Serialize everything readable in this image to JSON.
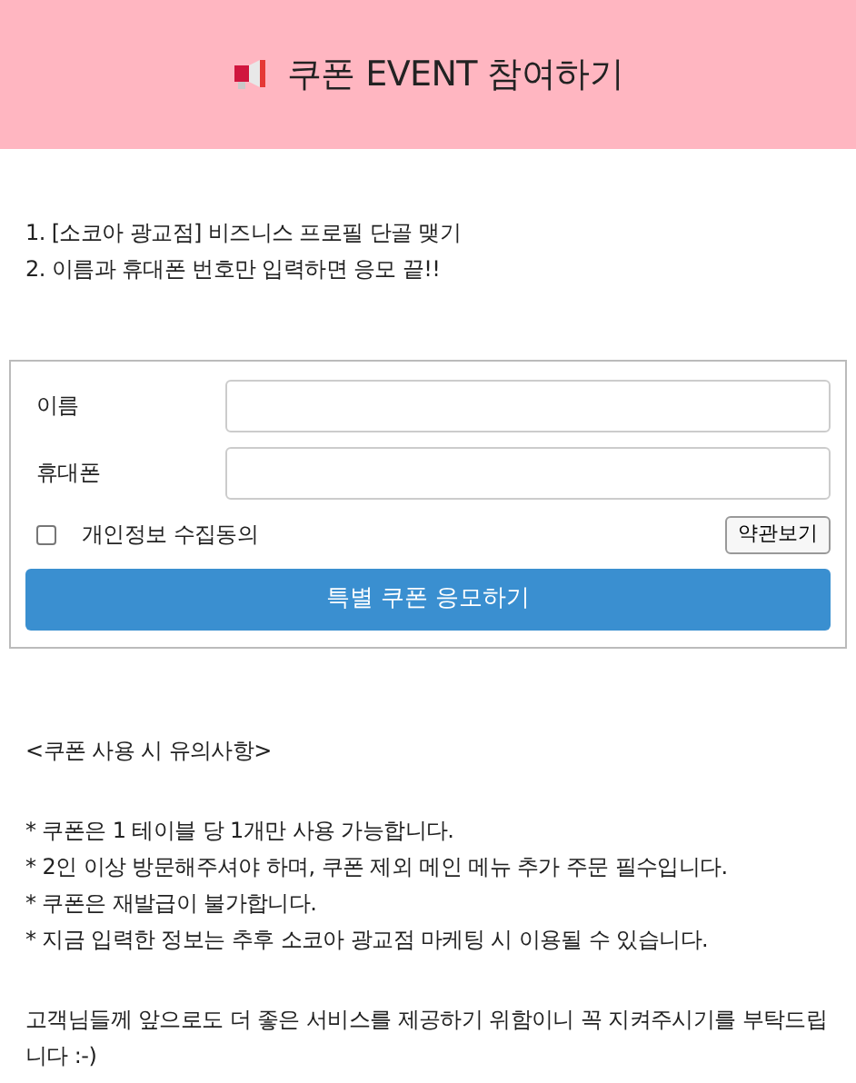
{
  "header": {
    "title": "쿠폰 EVENT 참여하기"
  },
  "intro": [
    "1. [소코아 광교점] 비즈니스 프로필 단골 맺기",
    "2. 이름과 휴대폰 번호만 입력하면 응모 끝!!"
  ],
  "form": {
    "fields": [
      {
        "label": "이름"
      },
      {
        "label": "휴대폰"
      }
    ],
    "consent": {
      "label": "개인정보 수집동의",
      "checked": false,
      "terms_button": "약관보기"
    },
    "submit": "특별 쿠폰 응모하기"
  },
  "notice": {
    "title": "<쿠폰 사용 시 유의사항>",
    "items": [
      "* 쿠폰은 1 테이블 당 1개만 사용 가능합니다.",
      "* 2인 이상 방문해주셔야 하며, 쿠폰 제외 메인 메뉴 추가 주문 필수입니다.",
      "* 쿠폰은 재발급이 불가합니다.",
      "* 지금 입력한 정보는 추후 소코아 광교점 마케팅 시 이용될 수 있습니다."
    ],
    "closing": "고객님들께 앞으로도 더 좋은 서비스를 제공하기 위함이니 꼭 지켜주시기를 부탁드립니다 :-)"
  }
}
